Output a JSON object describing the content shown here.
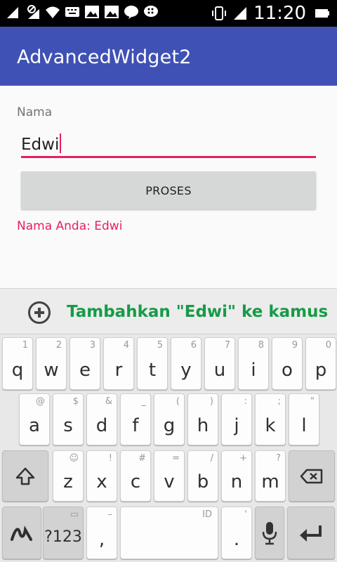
{
  "status_bar": {
    "time": "11:20",
    "icons": [
      "signal-1-icon",
      "signal-2-icon",
      "wifi-icon",
      "keyboard-icon",
      "gallery-icon",
      "gallery-icon",
      "line-icon",
      "bbm-icon",
      "vibrate-icon",
      "signal-icon",
      "battery-icon"
    ],
    "sim1_label": "1",
    "sim2_label": "2"
  },
  "app_bar": {
    "title": "AdvancedWidget2"
  },
  "form": {
    "name_label": "Nama",
    "name_value": "Edwi",
    "process_button": "PROSES",
    "result_text": "Nama Anda: Edwi"
  },
  "keyboard": {
    "suggestion": "Tambahkan \"Edwi\" ke kamus",
    "row1": [
      {
        "k": "q",
        "h": "1"
      },
      {
        "k": "w",
        "h": "2"
      },
      {
        "k": "e",
        "h": "3"
      },
      {
        "k": "r",
        "h": "4"
      },
      {
        "k": "t",
        "h": "5"
      },
      {
        "k": "y",
        "h": "6"
      },
      {
        "k": "u",
        "h": "7"
      },
      {
        "k": "i",
        "h": "8"
      },
      {
        "k": "o",
        "h": "9"
      },
      {
        "k": "p",
        "h": "0"
      }
    ],
    "row2": [
      {
        "k": "a",
        "h": "@"
      },
      {
        "k": "s",
        "h": "$"
      },
      {
        "k": "d",
        "h": "&"
      },
      {
        "k": "f",
        "h": "_"
      },
      {
        "k": "g",
        "h": "("
      },
      {
        "k": "h",
        "h": ")"
      },
      {
        "k": "j",
        "h": ":"
      },
      {
        "k": "k",
        "h": ";"
      },
      {
        "k": "l",
        "h": "\""
      }
    ],
    "row3": [
      {
        "k": "z",
        "h": "☺"
      },
      {
        "k": "x",
        "h": "!"
      },
      {
        "k": "c",
        "h": "#"
      },
      {
        "k": "v",
        "h": "="
      },
      {
        "k": "b",
        "h": "/"
      },
      {
        "k": "n",
        "h": "+"
      },
      {
        "k": "m",
        "h": "?"
      }
    ],
    "symbols_key": "?123",
    "comma_key": ",",
    "comma_hint": "–",
    "space_hint": "ID",
    "period_key": ".",
    "period_hint": "'"
  }
}
